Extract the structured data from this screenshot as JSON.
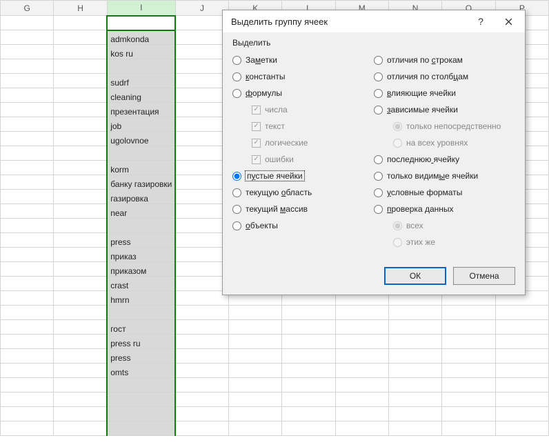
{
  "columns": [
    "G",
    "H",
    "I",
    "J",
    "K",
    "L",
    "M",
    "N",
    "O",
    "P"
  ],
  "selected_column_index": 2,
  "rows": [
    "",
    "admkonda",
    "kos ru",
    "",
    "sudrf",
    "cleaning",
    "презентация",
    "job",
    "ugolovnoe",
    "",
    "korm",
    "банку газировки",
    "газировка",
    "near",
    "",
    "press",
    "приказ",
    "приказом",
    "crast",
    "hmrn",
    "",
    "гост",
    "press ru",
    "press",
    "omts",
    "",
    "",
    "",
    ""
  ],
  "dialog": {
    "title": "Выделить группу ячеек",
    "group_label": "Выделить",
    "left": [
      {
        "kind": "radio",
        "key": "notes",
        "text": "Заметки",
        "u": [
          2
        ]
      },
      {
        "kind": "radio",
        "key": "constants",
        "text": "константы",
        "u": [
          0
        ]
      },
      {
        "kind": "radio",
        "key": "formulas",
        "text": "формулы",
        "u": [
          0
        ]
      },
      {
        "kind": "check",
        "key": "numbers",
        "text": "числа",
        "disabled": true,
        "checked": true
      },
      {
        "kind": "check",
        "key": "text",
        "text": "текст",
        "disabled": true,
        "checked": true
      },
      {
        "kind": "check",
        "key": "logical",
        "text": "логические",
        "disabled": true,
        "checked": true
      },
      {
        "kind": "check",
        "key": "errors",
        "text": "ошибки",
        "disabled": true,
        "checked": true
      },
      {
        "kind": "radio",
        "key": "blanks",
        "text": "пустые ячейки",
        "u": [
          1
        ],
        "selected": true,
        "focused": true
      },
      {
        "kind": "radio",
        "key": "curregion",
        "text": "текущую область",
        "u": [
          8
        ]
      },
      {
        "kind": "radio",
        "key": "curarray",
        "text": "текущий массив",
        "u": [
          8
        ]
      },
      {
        "kind": "radio",
        "key": "objects",
        "text": "объекты",
        "u": [
          0
        ]
      }
    ],
    "right": [
      {
        "kind": "radio",
        "key": "rowdiff",
        "text": "отличия по строкам",
        "u": [
          11
        ]
      },
      {
        "kind": "radio",
        "key": "coldiff",
        "text": "отличия по столбцам",
        "u": [
          16
        ]
      },
      {
        "kind": "radio",
        "key": "precedents",
        "text": "влияющие ячейки",
        "u": [
          0
        ]
      },
      {
        "kind": "radio",
        "key": "dependents",
        "text": "зависимые ячейки",
        "u": [
          0
        ]
      },
      {
        "kind": "subradio",
        "key": "direct",
        "text": "только непосредственно",
        "disabled": true,
        "selected": true
      },
      {
        "kind": "subradio",
        "key": "alllevels",
        "text": "на всех уровнях",
        "disabled": true
      },
      {
        "kind": "radio",
        "key": "lastcell",
        "text": "последнюю ячейку",
        "u": [
          9
        ]
      },
      {
        "kind": "radio",
        "key": "visible",
        "text": "только видимые ячейки",
        "u": [
          12
        ]
      },
      {
        "kind": "radio",
        "key": "condfmt",
        "text": "условные форматы",
        "u": [
          0
        ]
      },
      {
        "kind": "radio",
        "key": "validation",
        "text": "проверка данных",
        "u": [
          0
        ]
      },
      {
        "kind": "subradio",
        "key": "all",
        "text": "всех",
        "disabled": true,
        "selected": true
      },
      {
        "kind": "subradio",
        "key": "same",
        "text": "этих же",
        "disabled": true
      }
    ],
    "ok": "ОК",
    "cancel": "Отмена"
  }
}
